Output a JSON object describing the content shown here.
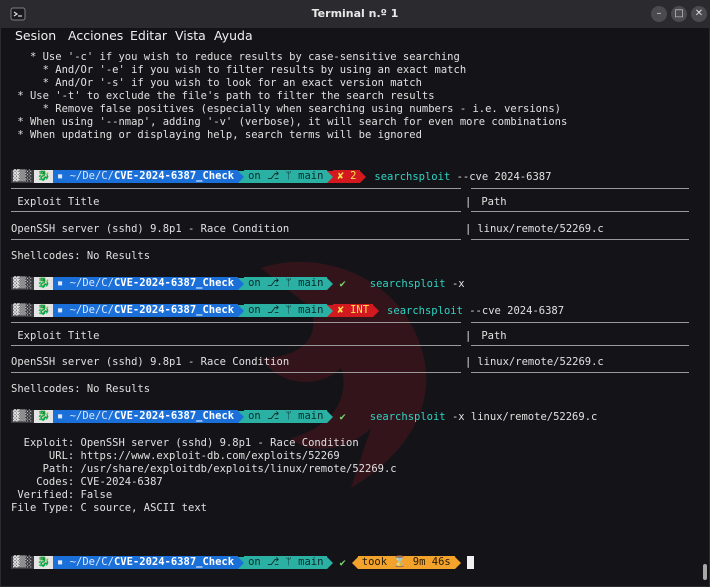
{
  "window": {
    "title": "Terminal n.º 1"
  },
  "menu": [
    "Sesion",
    "Acciones",
    "Editar",
    "Vista",
    "Ayuda"
  ],
  "help_lines": [
    "   * Use '-c' if you wish to reduce results by case-sensitive searching",
    "     * And/Or '-e' if you wish to filter results by using an exact match",
    "     * And/Or '-s' if you wish to look for an exact version match",
    " * Use '-t' to exclude the file's path to filter the search results",
    "     * Remove false positives (especially when searching using numbers - i.e. versions)",
    " * When using '--nmap', adding '-v' (verbose), it will search for even more combinations",
    " * When updating or displaying help, search terms will be ignored"
  ],
  "prompt": {
    "path_prefix": "~/De/C/",
    "path_dir": "CVE-2024-6387_Check",
    "git_label": "on",
    "branch": "main",
    "status_err1": "✘ 2",
    "status_err2": "✘ INT",
    "status_ok": "✔",
    "took_label": "took",
    "took_value": "9m 46s"
  },
  "commands": {
    "c1_name": "searchsploit",
    "c1_args": " --cve 2024-6387",
    "c2_name": "searchsploit",
    "c2_args": " -x",
    "c3_name": "searchsploit",
    "c3_args": " --cve 2024-6387",
    "c4_name": "searchsploit",
    "c4_args": " -x linux/remote/52269.c"
  },
  "results": {
    "col_title": " Exploit Title",
    "col_path": " Path",
    "row_title": "OpenSSH server (sshd) 9.8p1 - Race Condition",
    "row_path": " linux/remote/52269.c",
    "shellcodes": "Shellcodes: No Results",
    "sep": "|"
  },
  "exploit_info": [
    "  Exploit: OpenSSH server (sshd) 9.8p1 - Race Condition",
    "      URL: https://www.exploit-db.com/exploits/52269",
    "     Path: /usr/share/exploitdb/exploits/linux/remote/52269.c",
    "    Codes: CVE-2024-6387",
    " Verified: False",
    "File Type: C source, ASCII text"
  ],
  "colors": {
    "path_bg": "#1a6fd9",
    "git_bg": "#2bb1a3",
    "err_bg": "#d1191f",
    "took_bg": "#f3a32c",
    "cmd_fg": "#2fd3c3"
  }
}
